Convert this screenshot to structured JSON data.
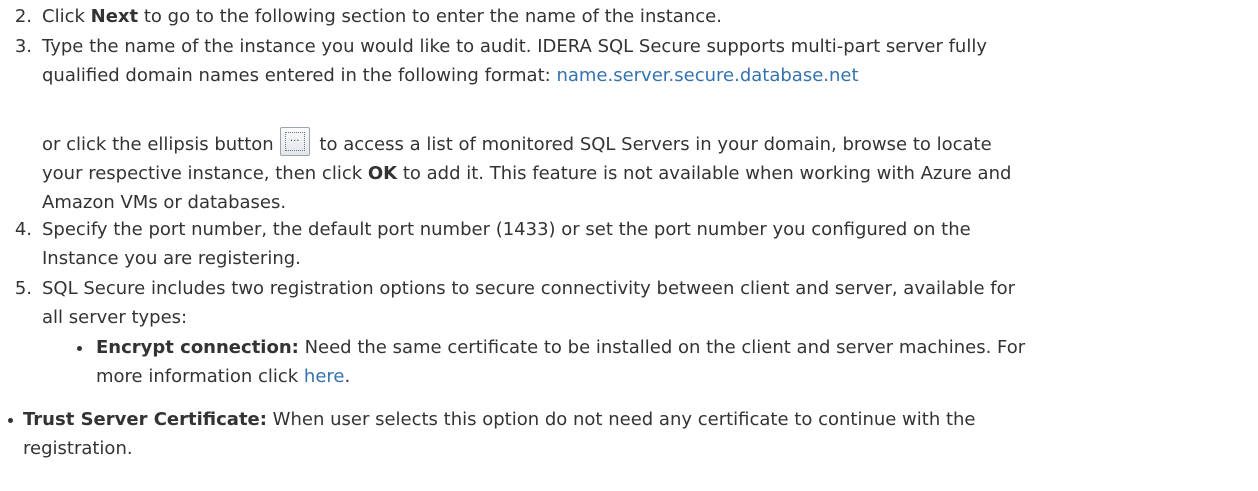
{
  "steps": [
    {
      "num": "2.",
      "pre": "Click ",
      "bold": "Next",
      "post": " to go to the following section to enter the name of the instance."
    },
    {
      "num": "3.",
      "line1": "Type the name of the instance you would like to audit. IDERA SQL Secure supports multi-part server fully",
      "line2": "qualified domain names entered in the following format: ",
      "format_link": "name.server.secure.database.net",
      "p2_pre": "or click the ellipsis button",
      "p2_post": " to access a list of monitored SQL Servers in your domain, browse to locate",
      "p2_line2_pre": "your respective instance, then click ",
      "p2_ok": "OK",
      "p2_line2_post": " to add it. This feature is not available when working with Azure and",
      "p2_line3": "Amazon VMs or databases."
    },
    {
      "num": "4.",
      "line1": "Specify the port number, the default port number (1433) or set the port number you configured on the",
      "line2": "Instance you are registering."
    },
    {
      "num": "5.",
      "line1": "SQL Secure includes two registration options to secure connectivity between client and server, available for",
      "line2": "all server types:"
    }
  ],
  "bullets": [
    {
      "label": "Encrypt connection:",
      "line1": " Need the same certificate to be installed on the client and server machines. For",
      "line2_pre": "more information click ",
      "link": "here",
      "line2_post": "."
    },
    {
      "label": "Trust Server Certificate:",
      "line1": " When user selects this option do not need any certificate to continue with the",
      "line2": "registration."
    }
  ],
  "ellipsis_button": {
    "glyph": "..."
  }
}
